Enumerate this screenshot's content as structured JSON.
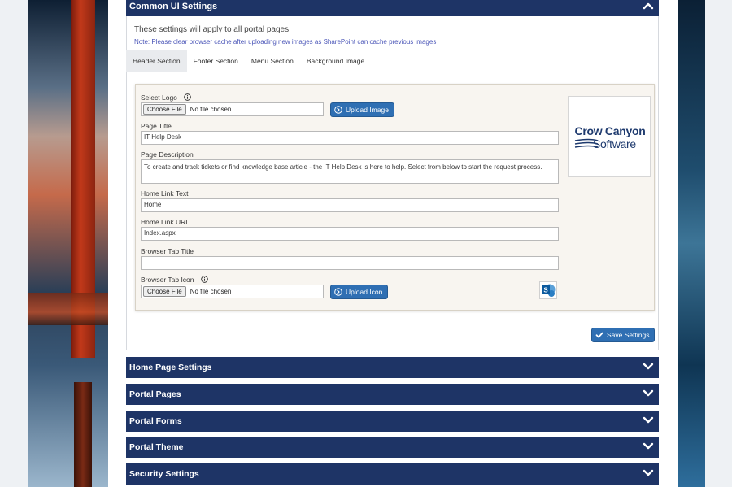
{
  "common_ui": {
    "title": "Common UI Settings",
    "intro": "These settings will apply to all portal pages",
    "note": "Note: Please clear browser cache after uploading new images as SharePoint can cache previous images"
  },
  "tabs": [
    {
      "label": "Header Section",
      "active": true
    },
    {
      "label": "Footer Section",
      "active": false
    },
    {
      "label": "Menu Section",
      "active": false
    },
    {
      "label": "Background Image",
      "active": false
    }
  ],
  "form": {
    "select_logo_label": "Select Logo",
    "choose_file_label": "Choose File",
    "no_file_text": "No file chosen",
    "upload_image_label": "Upload Image",
    "page_title_label": "Page Title",
    "page_title_value": "IT Help Desk",
    "page_description_label": "Page Description",
    "page_description_value": "To create and track tickets or find knowledge base article - the IT Help Desk is here to help. Select from below to start the request process.",
    "home_link_text_label": "Home Link Text",
    "home_link_text_value": "Home",
    "home_link_url_label": "Home Link URL",
    "home_link_url_value": "Index.aspx",
    "browser_tab_title_label": "Browser Tab Title",
    "browser_tab_title_value": "",
    "browser_tab_icon_label": "Browser Tab Icon",
    "upload_icon_label": "Upload Icon",
    "save_label": "Save Settings"
  },
  "logo": {
    "line1": "Crow Canyon",
    "line2": "Software"
  },
  "sections": [
    {
      "label": "Home Page Settings"
    },
    {
      "label": "Portal Pages"
    },
    {
      "label": "Portal Forms"
    },
    {
      "label": "Portal Theme"
    },
    {
      "label": "Security Settings"
    }
  ],
  "colors": {
    "header_bg": "#1e3466",
    "button_blue": "#2f6fb3",
    "form_bg": "#f8f5f0"
  },
  "icons": {
    "expand": "chevron-up-icon",
    "collapse": "chevron-down-icon",
    "info": "info-icon",
    "upload": "upload-arrow-icon",
    "save": "check-icon",
    "sharepoint": "sharepoint-icon"
  }
}
